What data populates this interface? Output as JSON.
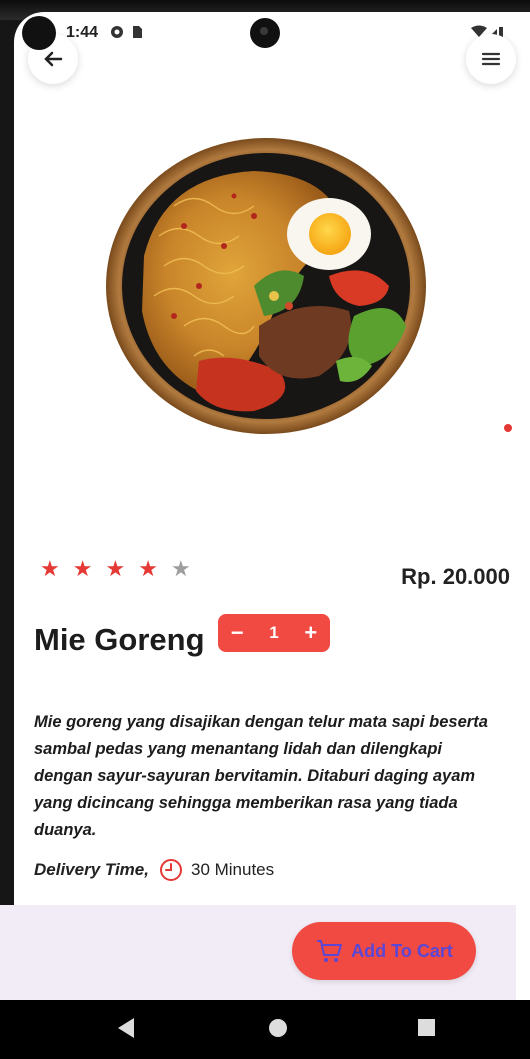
{
  "status_bar": {
    "time": "1:44"
  },
  "product": {
    "name": "Mie Goreng",
    "price": "Rp. 20.000",
    "rating": 4,
    "rating_max": 5,
    "quantity": "1",
    "description": "Mie goreng yang disajikan dengan telur mata sapi beserta sambal pedas yang menantang lidah dan dilengkapi dengan sayur-sayuran bervitamin. Ditaburi daging ayam yang dicincang sehingga memberikan rasa yang tiada duanya."
  },
  "stepper": {
    "minus": "−",
    "plus": "+"
  },
  "delivery": {
    "label": "Delivery Time,",
    "value": "30 Minutes"
  },
  "cart_button": {
    "label": "Add To Cart"
  },
  "colors": {
    "accent": "#f04a43",
    "cart_text": "#5a47d6",
    "star_on": "#e53935",
    "star_off": "#9e9e9e"
  },
  "icons": [
    "back-arrow-icon",
    "menu-icon",
    "star-icon",
    "minus-icon",
    "plus-icon",
    "clock-icon",
    "cart-icon",
    "nav-back-icon",
    "nav-home-icon",
    "nav-recent-icon"
  ]
}
